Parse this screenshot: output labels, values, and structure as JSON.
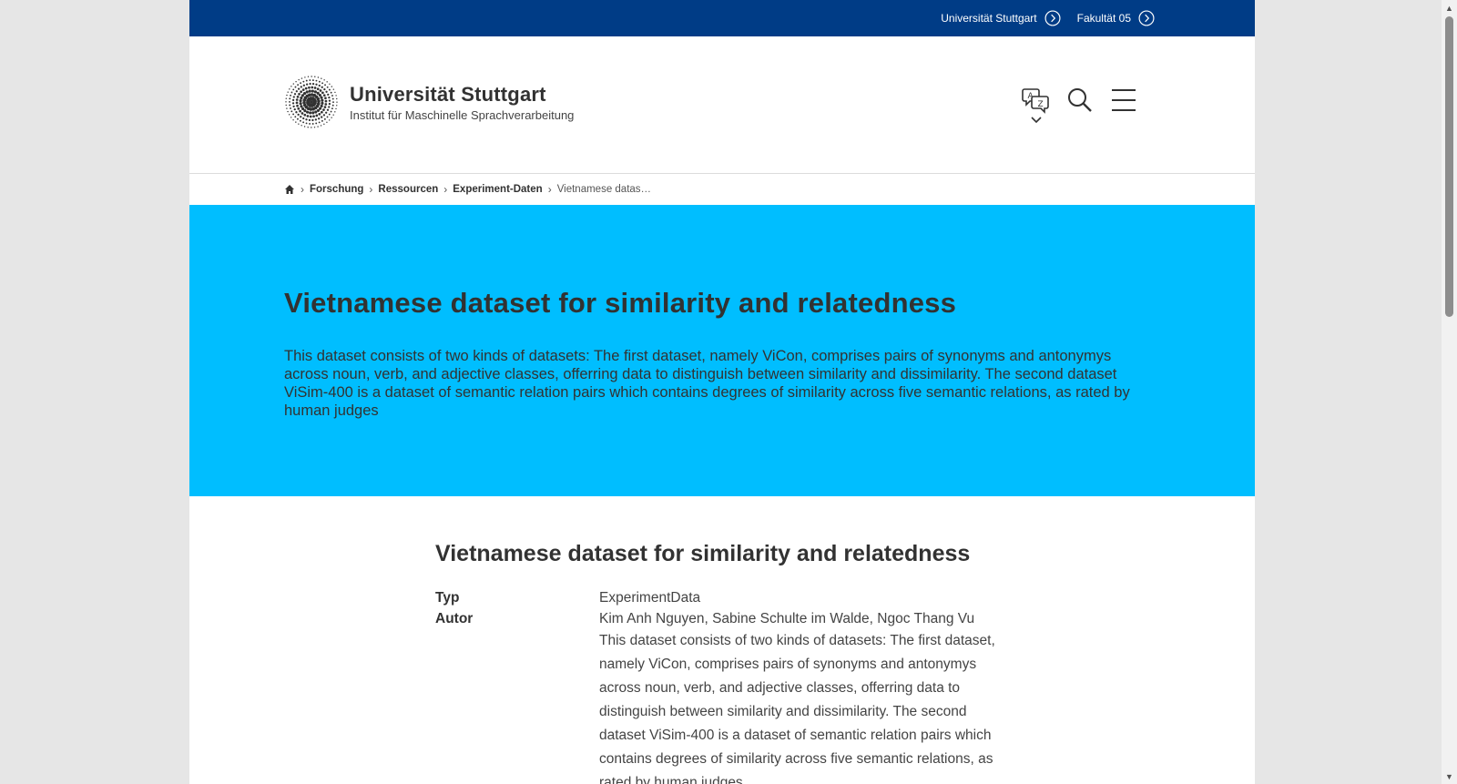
{
  "topbar": {
    "links": [
      {
        "label": "Universität Stuttgart"
      },
      {
        "label": "Fakultät 05"
      }
    ]
  },
  "header": {
    "university": "Universität Stuttgart",
    "institute": "Institut für Maschinelle Sprachverarbeitung"
  },
  "breadcrumb": {
    "items": [
      "Forschung",
      "Ressourcen",
      "Experiment-Daten"
    ],
    "current": "Vietnamese datas…"
  },
  "hero": {
    "title": "Vietnamese dataset for similarity and relatedness",
    "description": "This dataset consists of two kinds of datasets: The first dataset, namely ViCon, comprises pairs of synonyms and antonymys across noun, verb, and adjective classes, offerring data to distinguish between similarity and dissimilarity. The second dataset ViSim-400 is a dataset of semantic relation pairs which contains degrees of similarity across five semantic relations, as rated by human judges"
  },
  "detail": {
    "title": "Vietnamese dataset for similarity and relatedness",
    "type_label": "Typ",
    "type_value": "ExperimentData",
    "author_label": "Autor",
    "author_value": "Kim Anh Nguyen, Sabine Schulte im Walde, Ngoc Thang Vu",
    "description": "This dataset consists of two kinds of datasets: The first dataset, namely ViCon, comprises pairs of synonyms and antonymys across noun, verb, and adjective classes, offerring data to distinguish between similarity and dissimilarity. The second dataset ViSim-400 is a dataset of semantic relation pairs which contains degrees of similarity across five semantic relations, as rated by human judges"
  },
  "colors": {
    "topbar": "#003c86",
    "hero": "#00beff",
    "text": "#323232"
  }
}
